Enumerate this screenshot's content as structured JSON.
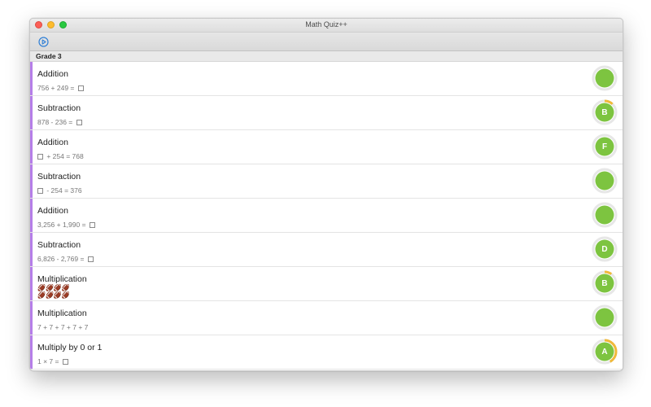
{
  "window": {
    "title": "Math Quiz++"
  },
  "toolbar": {
    "play_icon": "play-circle-icon"
  },
  "section": {
    "title": "Grade 3"
  },
  "colors": {
    "accent": "#b57ee8",
    "badge_green": "#7dc440",
    "badge_ring": "#e7e7e7",
    "progress": "#f0b93a",
    "toolbar_icon": "#2f7fd6"
  },
  "rows": [
    {
      "title": "Addition",
      "parts": [
        "756 + 249 = ",
        "[]"
      ],
      "grade": "",
      "progress": 0
    },
    {
      "title": "Subtraction",
      "parts": [
        "878 - 236 = ",
        "[]"
      ],
      "grade": "B",
      "progress": 0.12
    },
    {
      "title": "Addition",
      "parts": [
        "[]",
        " + 254 = 768"
      ],
      "grade": "F",
      "progress": 0
    },
    {
      "title": "Subtraction",
      "parts": [
        "[]",
        " - 254 = 376"
      ],
      "grade": "",
      "progress": 0
    },
    {
      "title": "Addition",
      "parts": [
        "3,256 + 1,990 = ",
        "[]"
      ],
      "grade": "",
      "progress": 0
    },
    {
      "title": "Subtraction",
      "parts": [
        "6,826 - 2,769 = ",
        "[]"
      ],
      "grade": "D",
      "progress": 0
    },
    {
      "title": "Multiplication",
      "parts": [],
      "footballs": [
        "🏈🏈🏈🏈",
        "🏈🏈🏈🏈"
      ],
      "grade": "B",
      "progress": 0.1
    },
    {
      "title": "Multiplication",
      "parts": [
        "7 + 7 + 7 + 7 + 7"
      ],
      "grade": "",
      "progress": 0
    },
    {
      "title": "Multiply by 0 or 1",
      "parts": [
        "1 × 7 = ",
        "[]"
      ],
      "grade": "A",
      "progress": 0.42
    }
  ]
}
